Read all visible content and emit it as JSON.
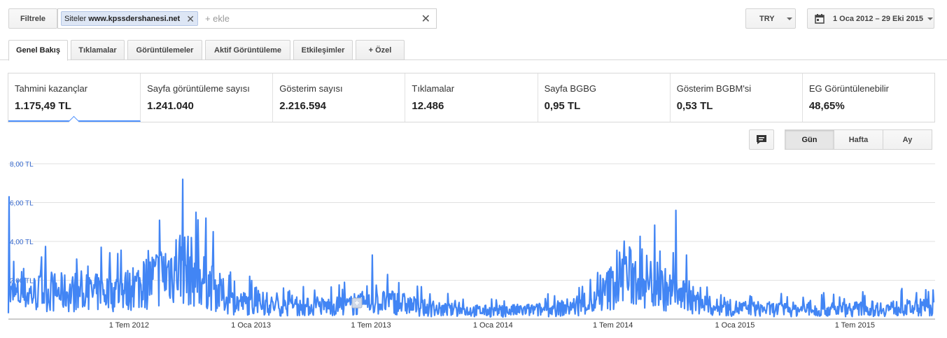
{
  "toolbar": {
    "filter_label": "Filtrele",
    "chip_prefix": "Siteler",
    "chip_site": "www.kpssdershanesi.net",
    "add_placeholder": "+ ekle",
    "currency": "TRY",
    "date_range": "1 Oca 2012 – 29 Eki 2015"
  },
  "tabs": [
    {
      "label": "Genel Bakış",
      "active": true
    },
    {
      "label": "Tıklamalar"
    },
    {
      "label": "Görüntülemeler"
    },
    {
      "label": "Aktif Görüntüleme"
    },
    {
      "label": "Etkileşimler"
    },
    {
      "label": "+  Özel"
    }
  ],
  "metrics": [
    {
      "label": "Tahmini kazançlar",
      "value": "1.175,49 TL"
    },
    {
      "label": "Sayfa görüntüleme sayısı",
      "value": "1.241.040"
    },
    {
      "label": "Gösterim sayısı",
      "value": "2.216.594"
    },
    {
      "label": "Tıklamalar",
      "value": "12.486"
    },
    {
      "label": "Sayfa BGBG",
      "value": "0,95 TL"
    },
    {
      "label": "Gösterim BGBM'si",
      "value": "0,53 TL"
    },
    {
      "label": "EG Görüntülenebilir",
      "value": "48,65%"
    }
  ],
  "granularity": {
    "day": "Gün",
    "week": "Hafta",
    "month": "Ay",
    "selected": "day"
  },
  "colors": {
    "line": "#4285f4",
    "axis_text": "#3366cc",
    "active_underline": "#4d90fe"
  },
  "chart_data": {
    "type": "line",
    "series": [
      {
        "name": "Tahmini kazançlar"
      }
    ],
    "x_range": [
      "2012-01-01",
      "2015-10-29"
    ],
    "ylim": [
      0,
      8
    ],
    "y_ticks": [
      "8,00 TL",
      "6,00 TL",
      "4,00 TL",
      "2,00 TL"
    ],
    "x_ticks": [
      "1 Tem 2012",
      "1 Oca 2013",
      "1 Tem 2013",
      "1 Oca 2014",
      "1 Tem 2014",
      "1 Oca 2015",
      "1 Tem 2015"
    ],
    "grid": true,
    "trend_points": [
      {
        "date": "2012-01-01",
        "value": 1.2
      },
      {
        "date": "2012-03-01",
        "value": 1.4
      },
      {
        "date": "2012-05-01",
        "value": 1.3
      },
      {
        "date": "2012-07-01",
        "value": 1.5
      },
      {
        "date": "2012-08-15",
        "value": 2.2
      },
      {
        "date": "2012-09-15",
        "value": 2.8
      },
      {
        "date": "2012-10-15",
        "value": 2.2
      },
      {
        "date": "2012-12-01",
        "value": 0.9
      },
      {
        "date": "2013-03-01",
        "value": 0.6
      },
      {
        "date": "2013-06-01",
        "value": 0.7
      },
      {
        "date": "2013-08-01",
        "value": 0.9
      },
      {
        "date": "2013-10-01",
        "value": 0.5
      },
      {
        "date": "2014-01-01",
        "value": 0.4
      },
      {
        "date": "2014-04-01",
        "value": 0.5
      },
      {
        "date": "2014-06-01",
        "value": 0.8
      },
      {
        "date": "2014-07-15",
        "value": 2.2
      },
      {
        "date": "2014-08-15",
        "value": 2.1
      },
      {
        "date": "2014-10-01",
        "value": 1.3
      },
      {
        "date": "2014-12-01",
        "value": 0.6
      },
      {
        "date": "2015-03-01",
        "value": 0.5
      },
      {
        "date": "2015-06-01",
        "value": 0.5
      },
      {
        "date": "2015-10-29",
        "value": 0.6
      }
    ],
    "peaks": [
      {
        "date": "2012-01-02",
        "value": 6.3
      },
      {
        "date": "2012-09-20",
        "value": 7.2
      },
      {
        "date": "2012-10-10",
        "value": 5.5
      },
      {
        "date": "2012-10-25",
        "value": 5.2
      },
      {
        "date": "2012-05-20",
        "value": 3.7
      },
      {
        "date": "2013-07-03",
        "value": 3.3
      },
      {
        "date": "2014-07-20",
        "value": 3.2
      },
      {
        "date": "2014-09-10",
        "value": 3.5
      },
      {
        "date": "2014-10-04",
        "value": 5.6
      },
      {
        "date": "2014-10-20",
        "value": 3.3
      },
      {
        "date": "2015-10-27",
        "value": 1.5
      }
    ]
  }
}
